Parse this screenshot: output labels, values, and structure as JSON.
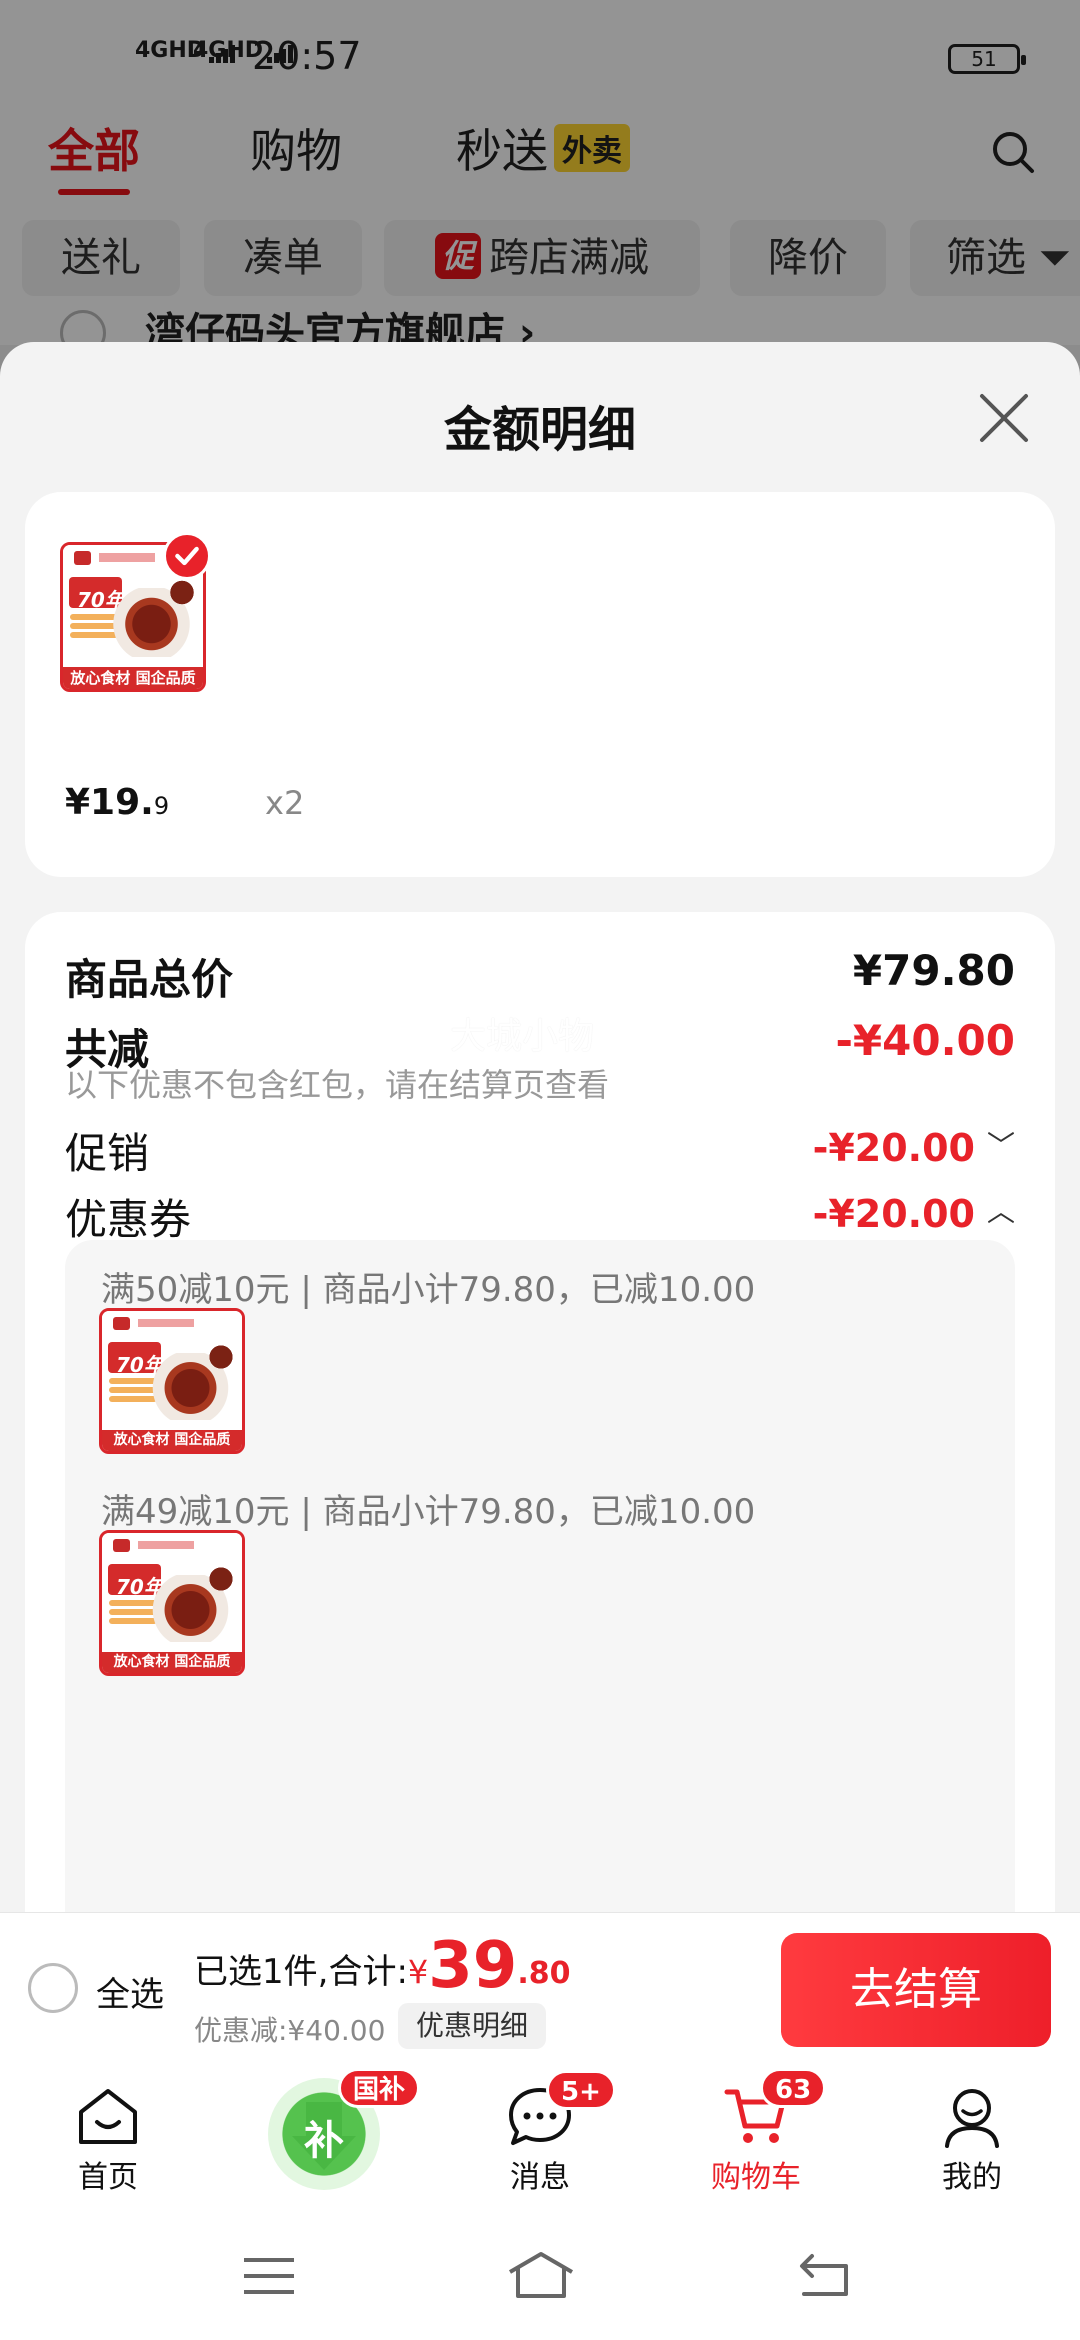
{
  "status_bar": {
    "signal1": "4GHD",
    "signal2": "4GHD",
    "time": "20:57",
    "battery": "51"
  },
  "top_tabs": {
    "all": "全部",
    "shopping": "购物",
    "flash": "秒送",
    "flash_tag": "外卖"
  },
  "filters": {
    "gift": "送礼",
    "bundle": "凑单",
    "promo_badge": "促",
    "cross_store": "跨店满减",
    "price_drop": "降价",
    "filter": "筛选"
  },
  "store_name": "湾仔码头官方旗舰店 ›",
  "sheet": {
    "title": "金额明细",
    "product": {
      "thumb_years": "70年",
      "thumb_footer": "放心食材 国企品质",
      "price_main": "¥19.",
      "price_decimal": "9",
      "quantity": "x2"
    },
    "total_label": "商品总价",
    "total_value": "¥79.80",
    "reduced_label": "共减",
    "reduced_value": "-¥40.00",
    "note": "以下优惠不包含红包，请在结算页查看",
    "watermark": "大城小物",
    "promo_label": "促销",
    "promo_value": "-¥20.00",
    "coupon_label": "优惠券",
    "coupon_value": "-¥20.00",
    "coupons": [
      {
        "text": "满50减10元 | 商品小计79.80，已减10.00"
      },
      {
        "text": "满49减10元 | 商品小计79.80，已减10.00"
      }
    ]
  },
  "checkout": {
    "select_all": "全选",
    "summary_prefix": "已选1件,合计:",
    "yen": "¥",
    "total_int": "39",
    "total_dec": ".80",
    "discount_text": "优惠减:¥40.00",
    "discount_chip": "优惠明细",
    "button": "去结算"
  },
  "tabbar": {
    "home": "首页",
    "subsidy_badge": "国补",
    "subsidy_char": "补",
    "messages": "消息",
    "messages_badge": "5+",
    "cart": "购物车",
    "cart_badge": "63",
    "mine": "我的"
  },
  "colors": {
    "accent": "#e8222a",
    "checkout_button": "#ff3b3f",
    "subsidy_green": "#55c24e"
  }
}
